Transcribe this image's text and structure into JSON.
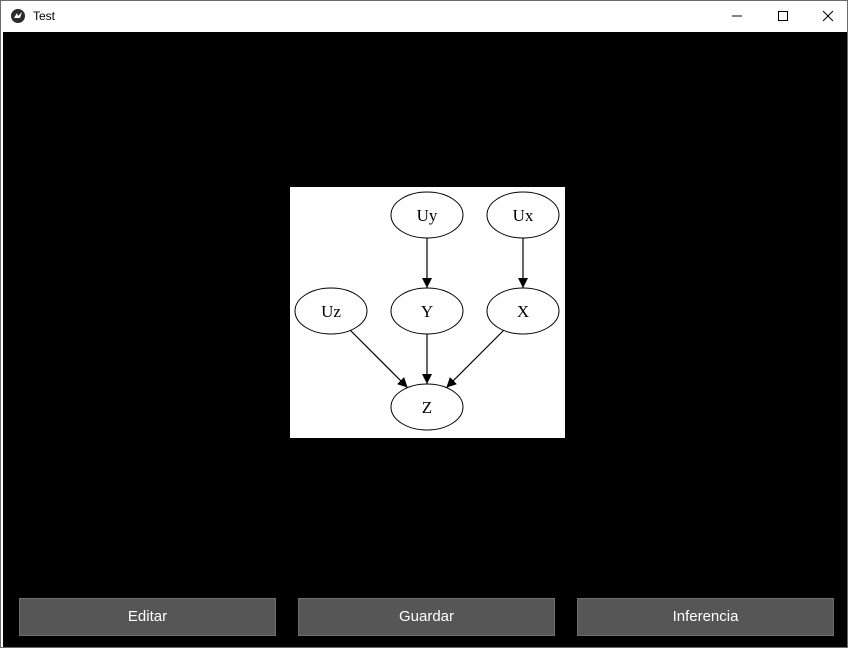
{
  "window": {
    "title": "Test",
    "app_icon": "kivy-logo-icon",
    "controls": [
      "minimize-icon",
      "maximize-icon",
      "close-icon"
    ]
  },
  "graph": {
    "nodes": [
      {
        "id": "Uy",
        "label": "Uy"
      },
      {
        "id": "Ux",
        "label": "Ux"
      },
      {
        "id": "Uz",
        "label": "Uz"
      },
      {
        "id": "Y",
        "label": "Y"
      },
      {
        "id": "X",
        "label": "X"
      },
      {
        "id": "Z",
        "label": "Z"
      }
    ],
    "edges": [
      {
        "from": "Uy",
        "to": "Y"
      },
      {
        "from": "Ux",
        "to": "X"
      },
      {
        "from": "Uz",
        "to": "Z"
      },
      {
        "from": "Y",
        "to": "Z"
      },
      {
        "from": "X",
        "to": "Z"
      }
    ]
  },
  "buttons": {
    "editar": "Editar",
    "guardar": "Guardar",
    "inferencia": "Inferencia"
  },
  "colors": {
    "canvas_background": "#000000",
    "button_background": "#565656",
    "button_text": "#ffffff",
    "graph_background": "#ffffff"
  }
}
